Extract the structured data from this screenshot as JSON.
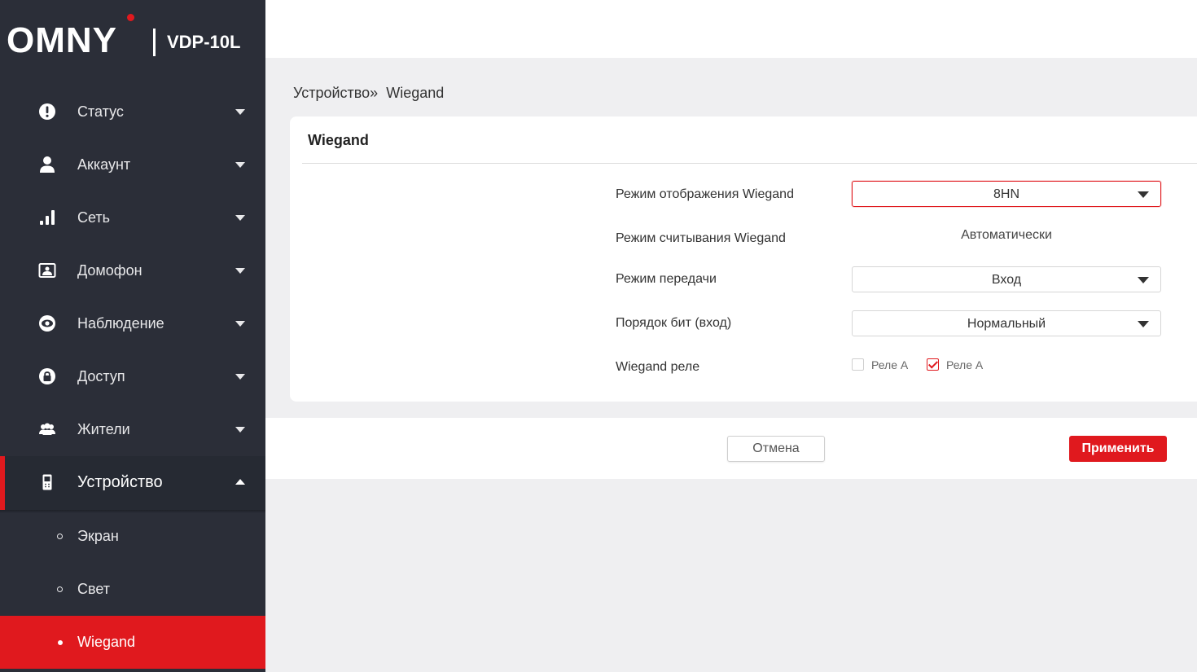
{
  "brand": {
    "logo": "OMNY",
    "model": "VDP-10L",
    "accent": "#e0191e"
  },
  "sidebar": {
    "items": [
      {
        "label": "Статус",
        "icon": "exclamation-circle-icon"
      },
      {
        "label": "Аккаунт",
        "icon": "user-icon"
      },
      {
        "label": "Сеть",
        "icon": "signal-bars-icon"
      },
      {
        "label": "Домофон",
        "icon": "intercom-picture-icon"
      },
      {
        "label": "Наблюдение",
        "icon": "eye-icon"
      },
      {
        "label": "Доступ",
        "icon": "lock-icon"
      },
      {
        "label": "Жители",
        "icon": "users-group-icon"
      },
      {
        "label": "Устройство",
        "icon": "device-icon",
        "expanded": true
      }
    ],
    "subitems": [
      {
        "label": "Экран"
      },
      {
        "label": "Свет"
      },
      {
        "label": "Wiegand",
        "active": true
      }
    ]
  },
  "breadcrumb": {
    "parent": "Устройство",
    "separator": "»",
    "current": "Wiegand"
  },
  "card": {
    "title": "Wiegand",
    "fields": [
      {
        "label": "Режим отображения Wiegand",
        "value": "8HN"
      },
      {
        "label": "Режим считывания Wiegand",
        "value": "Автоматически"
      },
      {
        "label": "Режим передачи",
        "value": "Вход"
      },
      {
        "label": "Порядок бит (вход)",
        "value": "Нормальный"
      },
      {
        "label": "Wiegand реле",
        "options": [
          {
            "label": "Реле А",
            "checked": false
          },
          {
            "label": "Реле А",
            "checked": true
          }
        ]
      }
    ]
  },
  "footer": {
    "cancel_label": "Отмена",
    "apply_label": "Применить"
  }
}
